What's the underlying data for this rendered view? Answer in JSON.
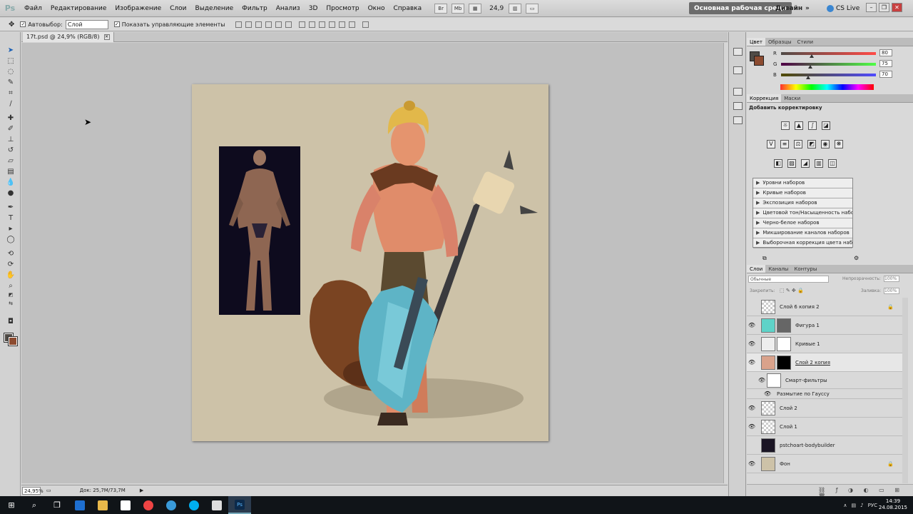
{
  "menubar": {
    "logo": "Ps",
    "items": [
      "Файл",
      "Редактирование",
      "Изображение",
      "Слои",
      "Выделение",
      "Фильтр",
      "Анализ",
      "3D",
      "Просмотр",
      "Окно",
      "Справка"
    ],
    "zoom": "24,9",
    "workspace_main": "Основная рабочая среда",
    "workspace_design": "Дизайн",
    "workspace_more": "»",
    "cs_live": "CS Live"
  },
  "options": {
    "autoselect_label": "Автовыбор:",
    "autoselect_value": "Слой",
    "show_controls_label": "Показать управляющие элементы"
  },
  "document": {
    "tab_title": "17t.psd @ 24,9% (RGB/8)"
  },
  "status": {
    "zoom": "24,95%",
    "doc_info": "Док: 25,7M/73,7M"
  },
  "color_panel": {
    "tabs": [
      "Цвет",
      "Образцы",
      "Стили"
    ],
    "channels": [
      {
        "label": "R",
        "value": "80"
      },
      {
        "label": "G",
        "value": "75"
      },
      {
        "label": "B",
        "value": "70"
      }
    ]
  },
  "adjustments": {
    "tabs": [
      "Коррекция",
      "Маски"
    ],
    "title": "Добавить корректировку",
    "presets": [
      "Уровни наборов",
      "Кривые наборов",
      "Экспозиция наборов",
      "Цветовой тон/Насыщенность наборов",
      "Черно-белое наборов",
      "Микширование каналов наборов",
      "Выборочная коррекция цвета наборов"
    ]
  },
  "layers": {
    "tabs": [
      "Слои",
      "Каналы",
      "Контуры"
    ],
    "blend_mode": "Обычные",
    "opacity_label": "Непрозрачность:",
    "opacity_value": "100%",
    "lock_label": "Закрепить:",
    "fill_label": "Заливка:",
    "fill_value": "100%",
    "items": [
      {
        "name": "Слой 6 копия 2",
        "visible": false
      },
      {
        "name": "Фигура 1",
        "visible": true
      },
      {
        "name": "Кривые 1",
        "visible": true
      },
      {
        "name": "Слой 2 копия",
        "visible": true
      },
      {
        "name": "Смарт-фильтры",
        "visible": true
      },
      {
        "name": "Размытие по Гауссу",
        "visible": true
      },
      {
        "name": "Слой 2",
        "visible": true
      },
      {
        "name": "Слой 1",
        "visible": true
      },
      {
        "name": "pstchoart-bodybuilder",
        "visible": false
      },
      {
        "name": "Фон",
        "visible": true
      }
    ]
  },
  "taskbar": {
    "lang": "РУС",
    "time": "14:39",
    "date": "24.08.2015"
  },
  "colors": {
    "foreground": "#504b46",
    "background": "#8c4b30",
    "artboard": "#cdc2a8"
  }
}
